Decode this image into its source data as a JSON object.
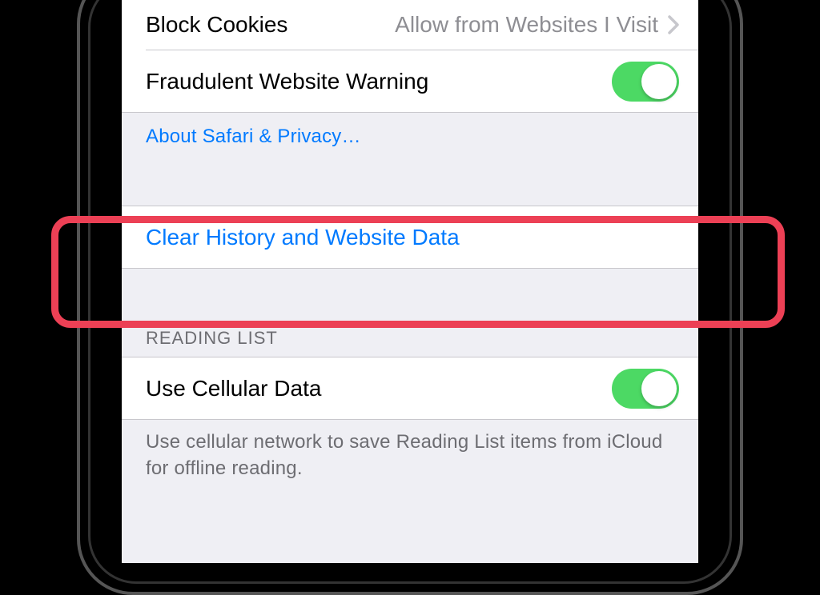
{
  "rows": {
    "blockCookies": {
      "label": "Block Cookies",
      "value": "Allow from Websites I Visit"
    },
    "fraudWarning": {
      "label": "Fraudulent Website Warning",
      "on": true
    },
    "aboutPrivacy": {
      "label": "About Safari & Privacy…"
    },
    "clearHistory": {
      "label": "Clear History and Website Data"
    },
    "cellularData": {
      "label": "Use Cellular Data",
      "on": true
    }
  },
  "sections": {
    "readingListHeader": "READING LIST",
    "readingListFooter": "Use cellular network to save Reading List items from iCloud for offline reading."
  },
  "colors": {
    "link": "#007aff",
    "toggleOn": "#4cd964",
    "highlight": "#ec4055"
  }
}
